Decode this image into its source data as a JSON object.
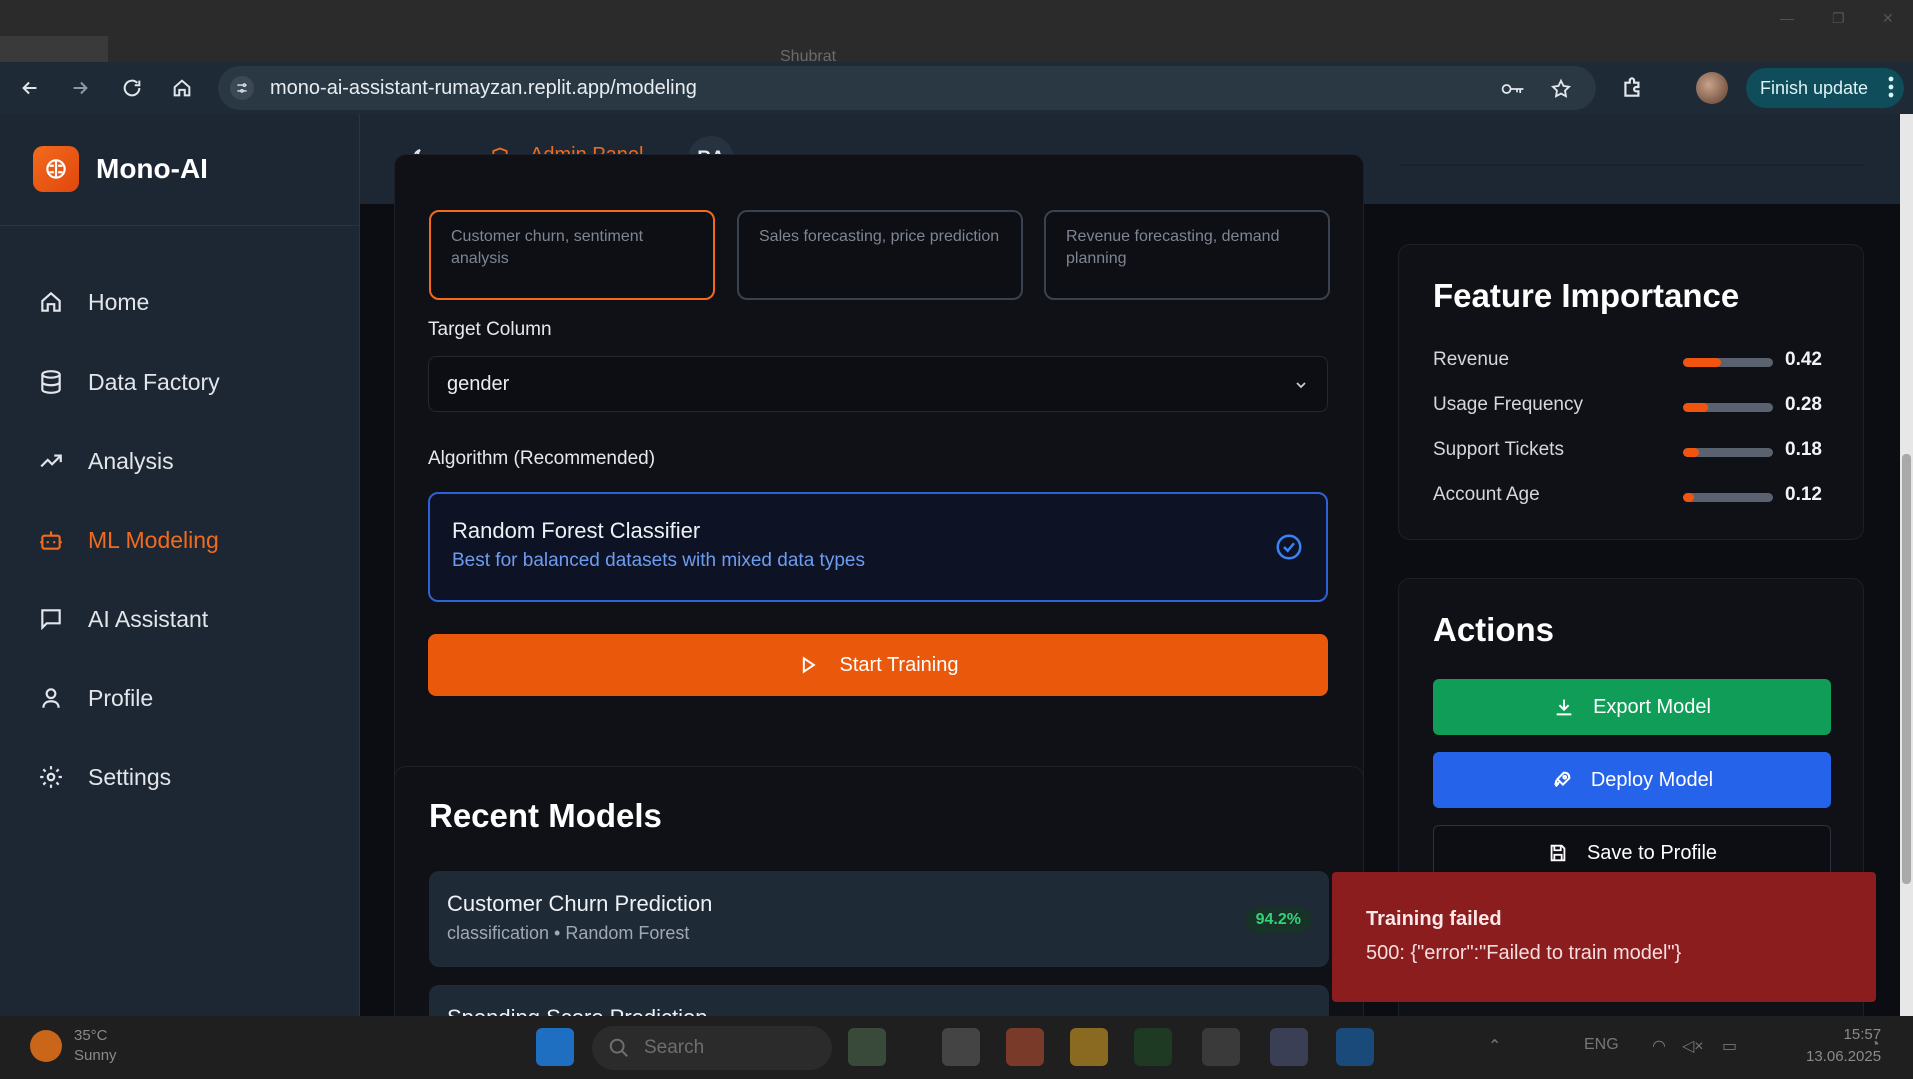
{
  "os": {
    "tab_ghost_text": "Shubrat"
  },
  "browser": {
    "url": "mono-ai-assistant-rumayzan.replit.app/modeling",
    "finish_update_label": "Finish update"
  },
  "app": {
    "brand_name": "Mono-AI",
    "sidebar": {
      "items": [
        {
          "label": "Home",
          "icon": "home-icon"
        },
        {
          "label": "Data Factory",
          "icon": "database-icon"
        },
        {
          "label": "Analysis",
          "icon": "trending-up-icon"
        },
        {
          "label": "ML Modeling",
          "icon": "bot-icon",
          "active": true
        },
        {
          "label": "AI Assistant",
          "icon": "chat-icon"
        },
        {
          "label": "Profile",
          "icon": "user-icon"
        },
        {
          "label": "Settings",
          "icon": "gear-icon"
        }
      ]
    },
    "topbar": {
      "admin_label": "Admin Panel",
      "avatar_initials": "RA"
    }
  },
  "training": {
    "model_types": [
      {
        "desc": "Customer churn, sentiment analysis",
        "selected": true
      },
      {
        "desc": "Sales forecasting, price prediction",
        "selected": false
      },
      {
        "desc": "Revenue forecasting, demand planning",
        "selected": false
      }
    ],
    "target_label": "Target Column",
    "target_value": "gender",
    "algorithm_label": "Algorithm (Recommended)",
    "algorithm_title": "Random Forest Classifier",
    "algorithm_sub": "Best for balanced datasets with mixed data types",
    "start_label": "Start Training"
  },
  "recent_models": {
    "title": "Recent Models",
    "items": [
      {
        "name": "Customer Churn Prediction",
        "meta": "classification • Random Forest",
        "accuracy": "94.2%"
      },
      {
        "name": "Spending Score Prediction",
        "meta": "",
        "accuracy": ""
      }
    ]
  },
  "feature_importance": {
    "title": "Feature Importance",
    "items": [
      {
        "label": "Revenue",
        "value": "0.42",
        "fraction": 0.42
      },
      {
        "label": "Usage Frequency",
        "value": "0.28",
        "fraction": 0.28
      },
      {
        "label": "Support Tickets",
        "value": "0.18",
        "fraction": 0.18
      },
      {
        "label": "Account Age",
        "value": "0.12",
        "fraction": 0.12
      }
    ]
  },
  "actions": {
    "title": "Actions",
    "export_label": "Export Model",
    "deploy_label": "Deploy Model",
    "save_label": "Save to Profile"
  },
  "toast": {
    "title": "Training failed",
    "message": "500: {\"error\":\"Failed to train model\"}"
  },
  "taskbar": {
    "weather_temp": "35°C",
    "weather_desc": "Sunny",
    "search_placeholder": "Search",
    "language": "ENG",
    "time": "15:57",
    "date": "13.06.2025"
  },
  "colors": {
    "accent": "#ea580c",
    "export": "#0f9d58",
    "deploy": "#2563eb",
    "toast": "#8b1d1f"
  }
}
